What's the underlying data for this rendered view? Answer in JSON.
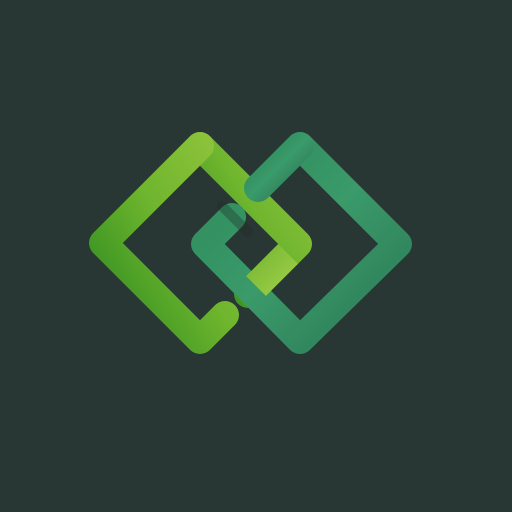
{
  "background_color": "#283733",
  "logo": {
    "icon": "interlocking-diamonds-logo",
    "left_diamond_colors": [
      "#2a8a1f",
      "#6fb52e",
      "#8fc43c"
    ],
    "right_diamond_colors": [
      "#2f8a5a",
      "#3a9a6a",
      "#2c7a55"
    ]
  }
}
